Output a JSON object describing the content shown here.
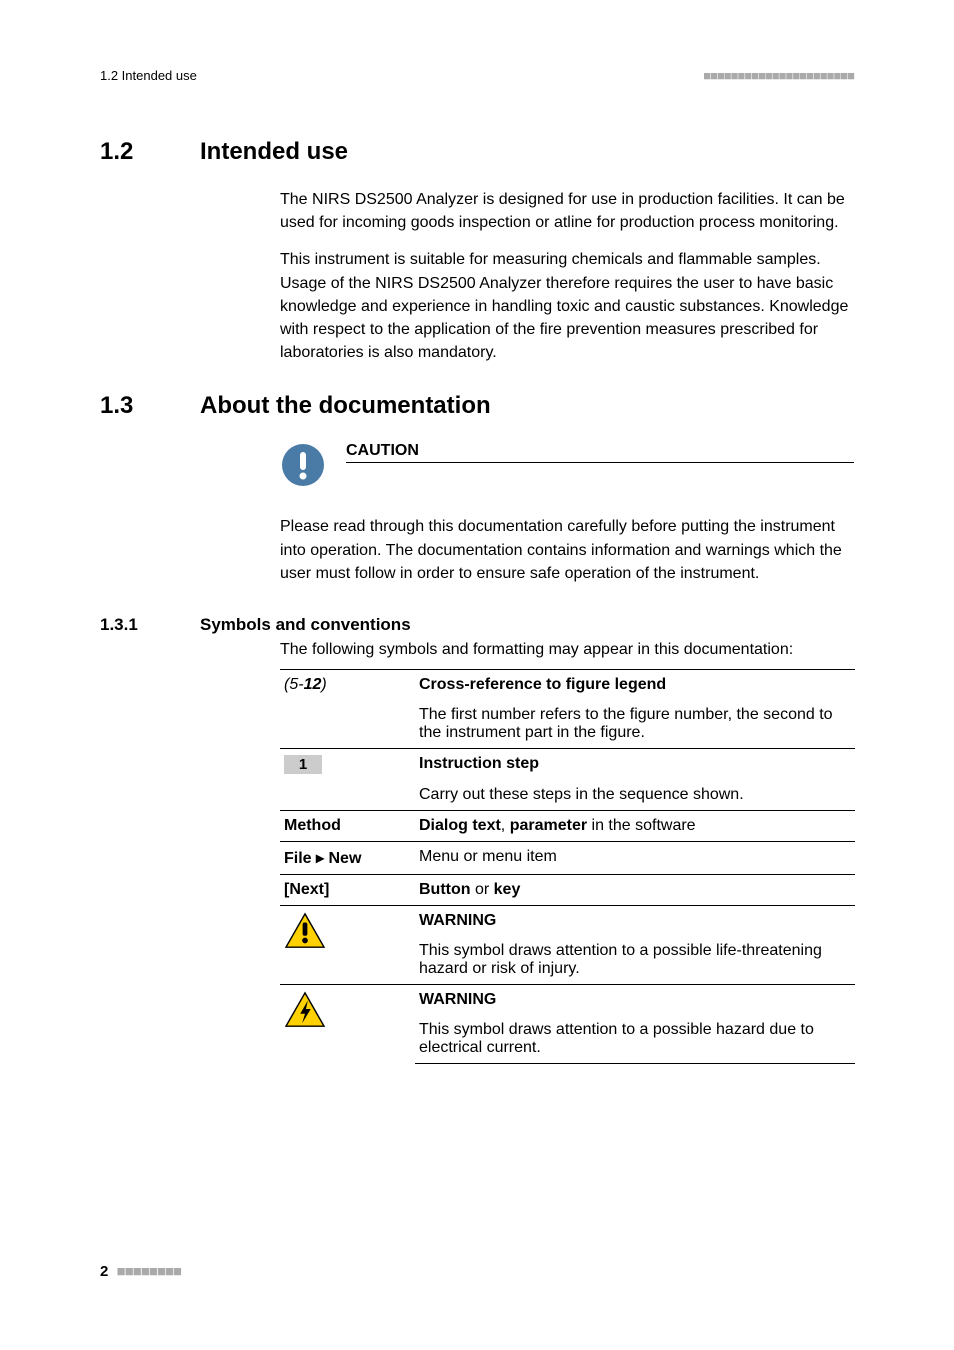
{
  "header": {
    "left": "1.2 Intended use"
  },
  "sec12": {
    "num": "1.2",
    "title": "Intended use",
    "p1": "The NIRS DS2500 Analyzer is designed for use in production facilities. It can be used for incoming goods inspection or atline for production process monitoring.",
    "p2": "This instrument is suitable for measuring chemicals and flammable samples. Usage of the NIRS DS2500 Analyzer therefore requires the user to have basic knowledge and experience in handling toxic and caustic substances. Knowledge with respect to the application of the fire prevention measures prescribed for laboratories is also mandatory."
  },
  "sec13": {
    "num": "1.3",
    "title": "About the documentation",
    "caution_label": "CAUTION",
    "caution_text": "Please read through this documentation carefully before putting the instrument into operation. The documentation contains information and warnings which the user must follow in order to ensure safe operation of the instrument."
  },
  "sec131": {
    "num": "1.3.1",
    "title": "Symbols and conventions",
    "intro": "The following symbols and formatting may appear in this documentation:"
  },
  "table": {
    "r1": {
      "c1a": "(5-",
      "c1b": "12",
      "c1c": ")",
      "title": "Cross-reference to figure legend",
      "desc": "The first number refers to the figure number, the second to the instrument part in the figure."
    },
    "r2": {
      "num": "1",
      "title": "Instruction step",
      "desc": "Carry out these steps in the sequence shown."
    },
    "r3": {
      "c1": "Method",
      "d1": "Dialog text",
      "sep": ", ",
      "d2": "parameter",
      "tail": " in the software"
    },
    "r4": {
      "c1": "File ▸ New",
      "desc": "Menu or menu item"
    },
    "r5": {
      "c1": "[Next]",
      "d1": "Button",
      "sep": " or ",
      "d2": "key"
    },
    "r6": {
      "title": "WARNING",
      "desc": "This symbol draws attention to a possible life-threatening hazard or risk of injury."
    },
    "r7": {
      "title": "WARNING",
      "desc": "This symbol draws attention to a possible hazard due to electrical current."
    }
  },
  "footer": {
    "page": "2"
  }
}
